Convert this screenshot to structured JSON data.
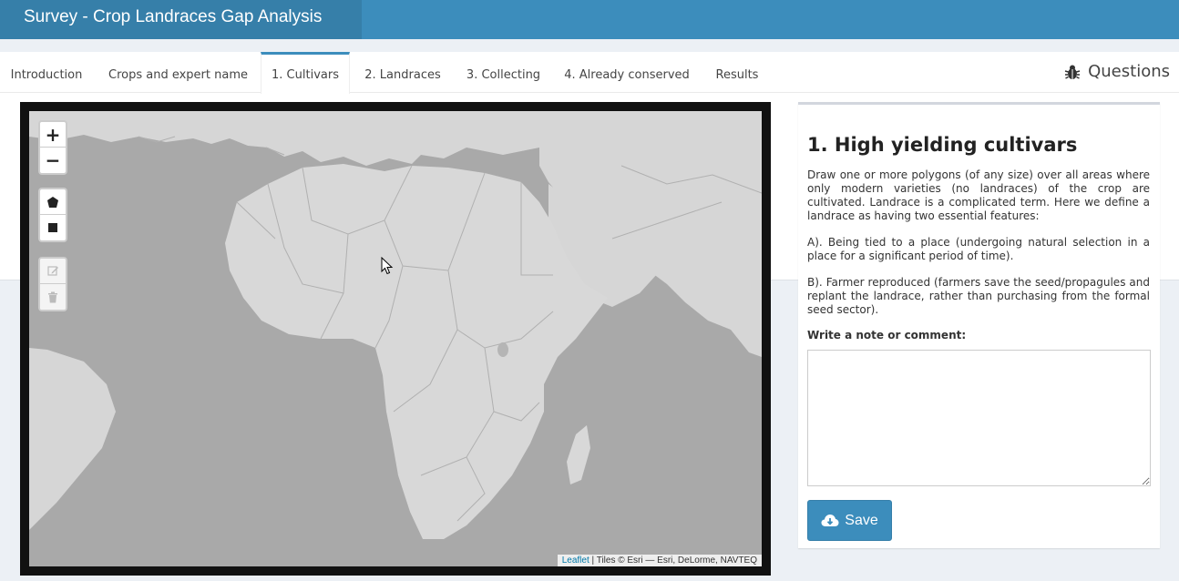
{
  "app": {
    "title": "Survey - Crop Landraces Gap Analysis"
  },
  "tabs": [
    {
      "label": "Introduction"
    },
    {
      "label": "Crops and expert name"
    },
    {
      "label": "1. Cultivars",
      "active": true
    },
    {
      "label": "2. Landraces"
    },
    {
      "label": "3. Collecting"
    },
    {
      "label": "4. Already conserved"
    },
    {
      "label": "Results"
    }
  ],
  "questions": {
    "label": "Questions",
    "icon": "bug-icon"
  },
  "map": {
    "zoom_in": "+",
    "zoom_out": "−",
    "draw_tools": [
      "polygon-icon",
      "rectangle-icon"
    ],
    "edit_tools": [
      "edit-icon",
      "trash-icon"
    ],
    "attribution": {
      "link": "Leaflet",
      "text": " | Tiles © Esri — Esri, DeLorme, NAVTEQ"
    }
  },
  "panel": {
    "title": "1. High yielding cultivars",
    "paragraphs": [
      "Draw one or more polygons (of any size) over all areas where only modern varieties (no landraces) of the crop are cultivated. Landrace is a complicated term. Here we define a landrace as having two essential features:",
      "A). Being tied to a place (undergoing natural selection in a place for a significant period of time).",
      "B). Farmer reproduced (farmers save the seed/propagules and replant the landrace, rather than purchasing from the formal seed sector)."
    ],
    "comment_label": "Write a note or comment:",
    "comment_value": "",
    "save_label": "Save"
  },
  "colors": {
    "header": "#3c8dbc",
    "brand": "#367fa9",
    "water": "#a8a8a8",
    "land": "#d8d8d8"
  }
}
